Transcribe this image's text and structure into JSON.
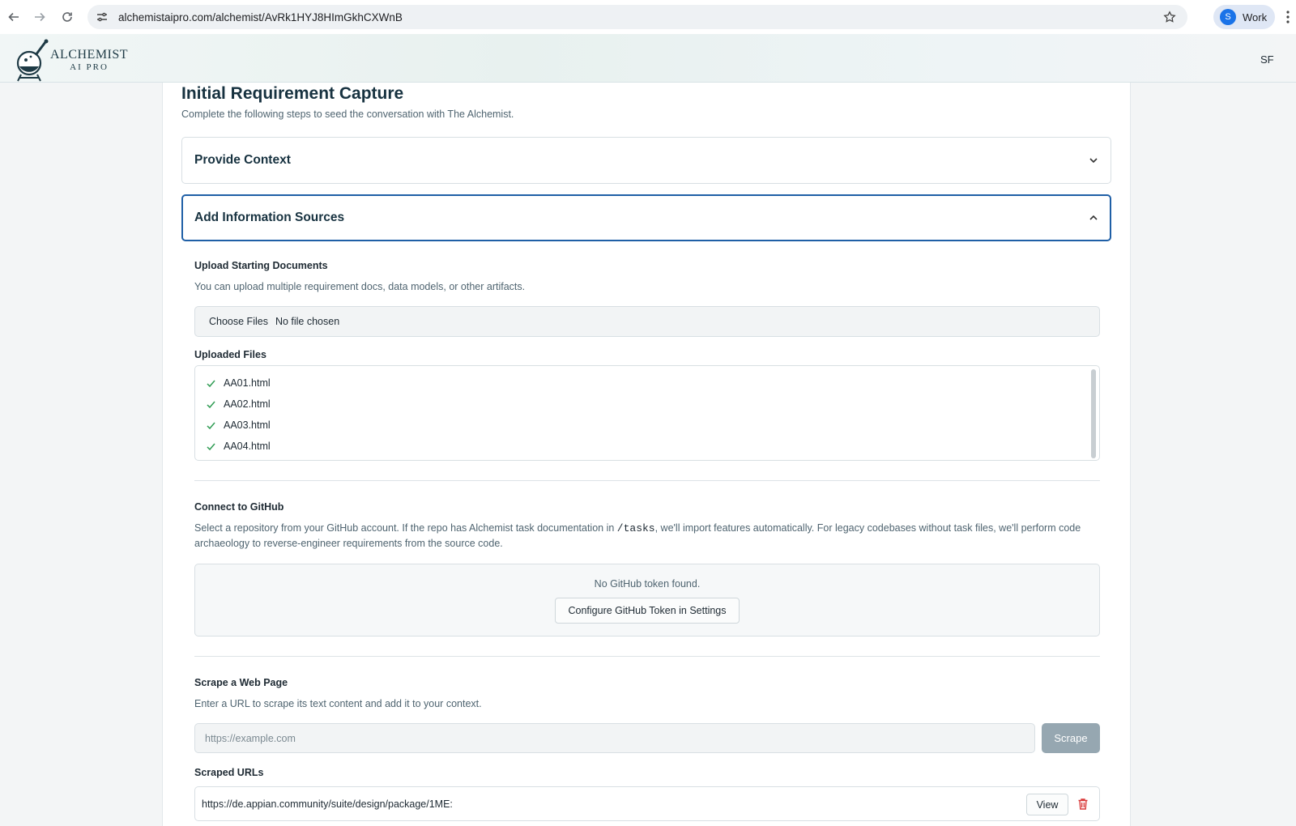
{
  "browser": {
    "url": "alchemistaipro.com/alchemist/AvRk1HYJ8HImGkhCXWnB",
    "profile_initial": "S",
    "profile_label": "Work"
  },
  "app": {
    "logo_line1": "ALCHEMIST",
    "logo_line2": "AI PRO",
    "user_initials": "SF"
  },
  "page": {
    "title": "Initial Requirement Capture",
    "subtitle": "Complete the following steps to seed the conversation with The Alchemist."
  },
  "accordions": [
    {
      "title": "Provide Context",
      "expanded": false
    },
    {
      "title": "Add Information Sources",
      "expanded": true
    }
  ],
  "upload": {
    "label": "Upload Starting Documents",
    "description": "You can upload multiple requirement docs, data models, or other artifacts.",
    "choose_button": "Choose Files",
    "file_status": "No file chosen",
    "uploaded_label": "Uploaded Files",
    "files": [
      "AA01.html",
      "AA02.html",
      "AA03.html",
      "AA04.html"
    ]
  },
  "github": {
    "label": "Connect to GitHub",
    "desc_before": "Select a repository from your GitHub account. If the repo has Alchemist task documentation in ",
    "desc_code": "/tasks",
    "desc_after": ", we'll import features automatically. For legacy codebases without task files, we'll perform code archaeology to reverse-engineer requirements from the source code.",
    "no_token_message": "No GitHub token found.",
    "configure_button": "Configure GitHub Token in Settings"
  },
  "scrape": {
    "label": "Scrape a Web Page",
    "description": "Enter a URL to scrape its text content and add it to your context.",
    "placeholder": "https://example.com",
    "button": "Scrape",
    "scraped_label": "Scraped URLs",
    "urls": [
      "https://de.appian.community/suite/design/package/1ME:"
    ],
    "view_button": "View"
  },
  "colors": {
    "accent_border": "#1f5fa6",
    "check_green": "#2e9b52",
    "delete_red": "#d93a3a",
    "disabled_button": "#96a7b1"
  }
}
